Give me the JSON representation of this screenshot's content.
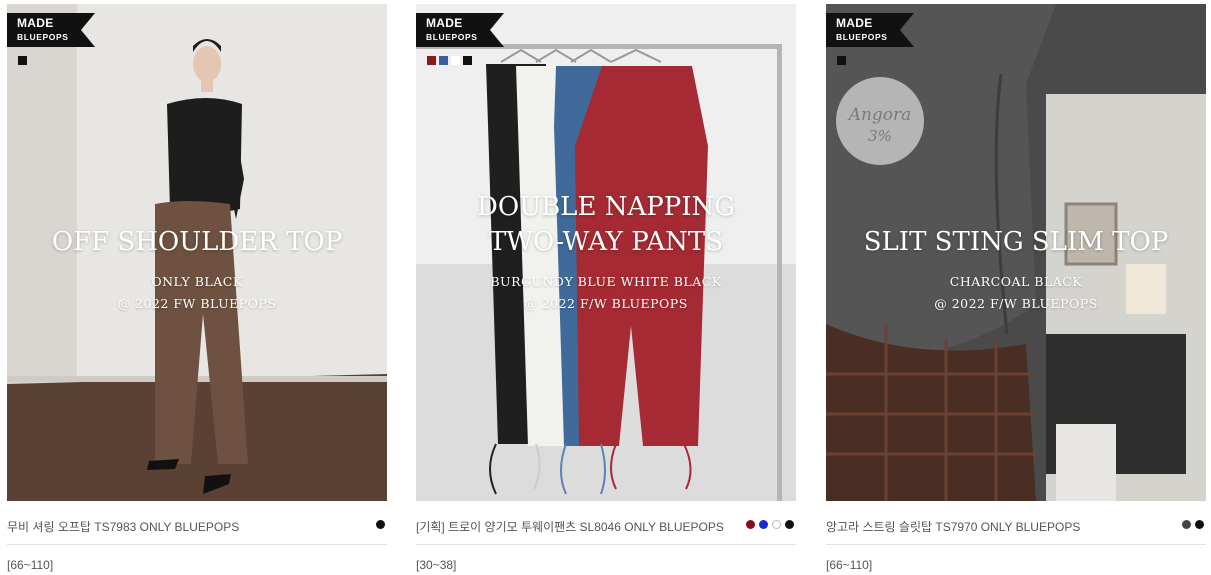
{
  "products": [
    {
      "badge": {
        "line1": "MADE",
        "line2": "BLUEPOPS"
      },
      "swatch_colors": [
        "#111111"
      ],
      "headline": [
        "OFF SHOULDER TOP"
      ],
      "sub1": "ONLY  BLACK",
      "sub2": "@ 2022 FW BLUEPOPS",
      "name": "무비 셔링 오프탑 TS7983 ONLY BLUEPOPS",
      "color_dots": [
        "#111111"
      ],
      "size": "[66~110]"
    },
    {
      "badge": {
        "line1": "MADE",
        "line2": "BLUEPOPS"
      },
      "swatch_colors": [
        "#8b1a1a",
        "#3b5fa0",
        "#ffffff",
        "#111111"
      ],
      "headline": [
        "DOUBLE NAPPING",
        "TWO-WAY PANTS"
      ],
      "sub1": "BURGUNDY  BLUE  WHITE  BLACK",
      "sub2": "@ 2022 F/W BLUEPOPS",
      "name": "[기획] 트로이 양기모 투웨이팬츠 SL8046 ONLY BLUEPOPS",
      "color_dots": [
        "#8b0a1a",
        "#1a2bd6",
        "#ffffff",
        "#111111"
      ],
      "size": "[30~38]"
    },
    {
      "badge": {
        "line1": "MADE",
        "line2": "BLUEPOPS"
      },
      "swatch_colors": [
        "#111111"
      ],
      "stamp": {
        "name": "Angora",
        "percent": "3%"
      },
      "headline": [
        "SLIT STING SLIM TOP"
      ],
      "sub1": "CHARCOAL  BLACK",
      "sub2": "@ 2022 F/W BLUEPOPS",
      "name": "앙고라 스트링 슬릿탑 TS7970 ONLY BLUEPOPS",
      "color_dots": [
        "#444444",
        "#111111"
      ],
      "size": "[66~110]"
    }
  ]
}
